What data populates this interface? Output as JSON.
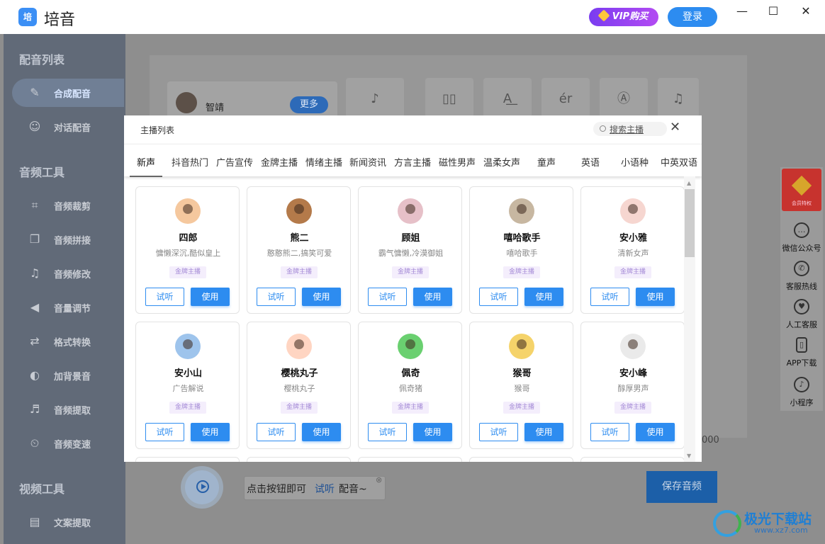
{
  "app": {
    "logo_text": "培",
    "title": "培音",
    "vip_label": "VIP购买",
    "login_label": "登录",
    "window_controls": {
      "minimize": "—",
      "maximize": "☐",
      "close": "✕"
    }
  },
  "sidebar": {
    "sections": [
      {
        "title": "配音列表"
      },
      {
        "title": "音频工具"
      },
      {
        "title": "视频工具"
      }
    ],
    "items": [
      {
        "label": "合成配音",
        "icon": "mic-icon",
        "glyph": "✎",
        "active": true
      },
      {
        "label": "对话配音",
        "icon": "users-icon",
        "glyph": "☺",
        "active": false
      },
      {
        "label": "音频裁剪",
        "icon": "crop-icon",
        "glyph": "⌗",
        "active": false
      },
      {
        "label": "音频拼接",
        "icon": "merge-icon",
        "glyph": "❐",
        "active": false
      },
      {
        "label": "音频修改",
        "icon": "music-icon",
        "glyph": "♫",
        "active": false
      },
      {
        "label": "音量调节",
        "icon": "volume-icon",
        "glyph": "◀",
        "active": false
      },
      {
        "label": "格式转换",
        "icon": "convert-icon",
        "glyph": "⇄",
        "active": false
      },
      {
        "label": "加背景音",
        "icon": "bgm-icon",
        "glyph": "◐",
        "active": false
      },
      {
        "label": "音频提取",
        "icon": "extract-icon",
        "glyph": "♬",
        "active": false
      },
      {
        "label": "音频变速",
        "icon": "speed-icon",
        "glyph": "⏲",
        "active": false
      },
      {
        "label": "文案提取",
        "icon": "document-icon",
        "glyph": "▤",
        "active": false
      }
    ]
  },
  "background": {
    "voice_name": "智靖",
    "more_label": "更多",
    "tool_glyphs": [
      "♪",
      "▯▯",
      "A͟",
      "ér",
      "Ⓐ",
      "♫"
    ],
    "hint_pre": "点击按钮即可",
    "hint_link": "试听",
    "hint_post": "配音~",
    "hint_close": "⊗",
    "save_label": "保存音频",
    "number_fragment": "000"
  },
  "float_panel": {
    "vip_text": "会员特权",
    "items": [
      {
        "label": "微信公众号",
        "icon": "wechat-icon",
        "glyph": "…"
      },
      {
        "label": "客服热线",
        "icon": "phone-icon",
        "glyph": "✆"
      },
      {
        "label": "人工客服",
        "icon": "service-icon",
        "glyph": "♥"
      },
      {
        "label": "APP下载",
        "icon": "mobile-icon",
        "glyph": "▯"
      },
      {
        "label": "小程序",
        "icon": "mini-program-icon",
        "glyph": "♪"
      }
    ]
  },
  "watermark": {
    "title": "极光下载站",
    "url": "www.xz7.com"
  },
  "modal": {
    "title": "主播列表",
    "search_label": "搜索主播",
    "close_glyph": "✕",
    "tabs": [
      "新声",
      "抖音热门",
      "广告宣传",
      "金牌主播",
      "情绪主播",
      "新闻资讯",
      "方言主播",
      "磁性男声",
      "温柔女声",
      "童声",
      "英语",
      "小语种",
      "中英双语"
    ],
    "active_tab": "新声",
    "listen_label": "试听",
    "use_label": "使用",
    "cards": [
      {
        "name": "四郎",
        "desc": "慵懒深沉,酷似皇上",
        "tag": "金牌主播",
        "avatar": "#f5c89e"
      },
      {
        "name": "熊二",
        "desc": "憨憨熊二,搞笑可爱",
        "tag": "金牌主播",
        "avatar": "#b47a4a"
      },
      {
        "name": "顾姐",
        "desc": "霸气慵懒,冷漠御姐",
        "tag": "金牌主播",
        "avatar": "#e6c0c8"
      },
      {
        "name": "嘻哈歌手",
        "desc": "嘻哈歌手",
        "tag": "金牌主播",
        "avatar": "#c7b7a1"
      },
      {
        "name": "安小雅",
        "desc": "清新女声",
        "tag": "金牌主播",
        "avatar": "#f6d6d0"
      },
      {
        "name": "安小山",
        "desc": "广告解说",
        "tag": "金牌主播",
        "avatar": "#9ec4ec"
      },
      {
        "name": "樱桃丸子",
        "desc": "樱桃丸子",
        "tag": "金牌主播",
        "avatar": "#ffd5c2"
      },
      {
        "name": "佩奇",
        "desc": "佩奇猪",
        "tag": "金牌主播",
        "avatar": "#6ad070"
      },
      {
        "name": "猴哥",
        "desc": "猴哥",
        "tag": "金牌主播",
        "avatar": "#f5d36a"
      },
      {
        "name": "安小峰",
        "desc": "醇厚男声",
        "tag": "金牌主播",
        "avatar": "#eaeaea"
      }
    ]
  }
}
